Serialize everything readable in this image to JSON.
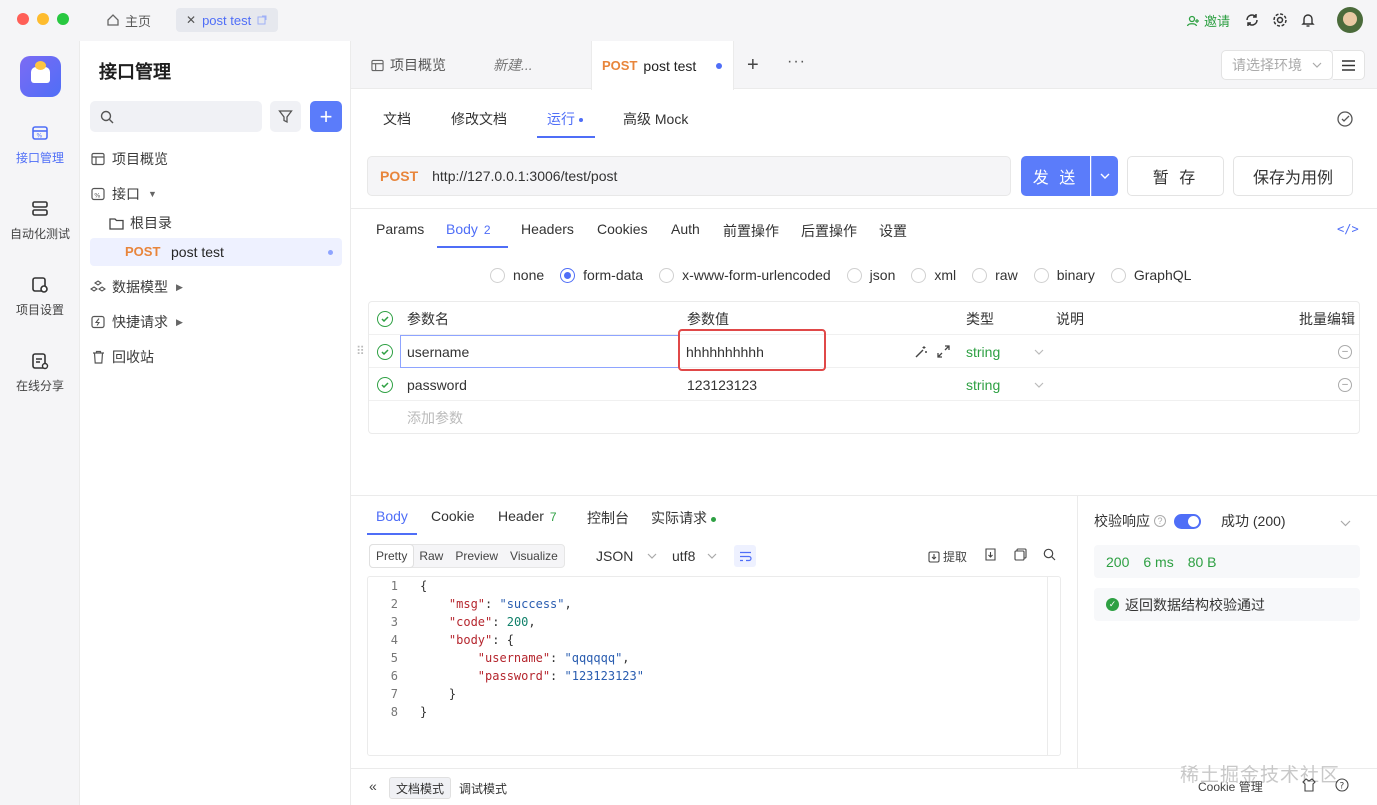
{
  "titlebar": {
    "home_label": "主页",
    "file_tab_label": "post test",
    "invite_label": "邀请"
  },
  "rail": {
    "items": [
      {
        "label": "接口管理",
        "icon": "api-icon"
      },
      {
        "label": "自动化测试",
        "icon": "automation-icon"
      },
      {
        "label": "项目设置",
        "icon": "project-settings-icon"
      },
      {
        "label": "在线分享",
        "icon": "share-icon"
      }
    ]
  },
  "sidebar": {
    "title": "接口管理",
    "tree": [
      {
        "label": "项目概览"
      },
      {
        "label": "接口"
      },
      {
        "label": "根目录"
      },
      {
        "method": "POST",
        "label": "post test"
      },
      {
        "label": "数据模型"
      },
      {
        "label": "快捷请求"
      },
      {
        "label": "回收站"
      }
    ]
  },
  "tabs": {
    "overview": "项目概览",
    "new": "新建...",
    "active_method": "POST",
    "active_label": "post test",
    "env_placeholder": "请选择环境"
  },
  "subtabs": [
    "文档",
    "修改文档",
    "运行",
    "高级 Mock"
  ],
  "request": {
    "method": "POST",
    "url": "http://127.0.0.1:3006/test/post",
    "send_label": "发 送",
    "save_label": "暂 存",
    "save_case_label": "保存为用例"
  },
  "req_tabs": {
    "params": "Params",
    "body": "Body",
    "body_count": "2",
    "headers": "Headers",
    "cookies": "Cookies",
    "auth": "Auth",
    "pre": "前置操作",
    "post": "后置操作",
    "settings": "设置"
  },
  "body_types": [
    "none",
    "form-data",
    "x-www-form-urlencoded",
    "json",
    "xml",
    "raw",
    "binary",
    "GraphQL"
  ],
  "body_type_selected": "form-data",
  "params_table": {
    "headers": {
      "name": "参数名",
      "value": "参数值",
      "type": "类型",
      "desc": "说明",
      "bulk": "批量编辑"
    },
    "rows": [
      {
        "name": "username",
        "value": "hhhhhhhhhh",
        "type": "string"
      },
      {
        "name": "password",
        "value": "123123123",
        "type": "string"
      }
    ],
    "add_placeholder": "添加参数"
  },
  "response": {
    "tabs": {
      "body": "Body",
      "cookie": "Cookie",
      "header": "Header",
      "header_count": "7",
      "console": "控制台",
      "actual": "实际请求"
    },
    "view_modes": [
      "Pretty",
      "Raw",
      "Preview",
      "Visualize"
    ],
    "format": "JSON",
    "encoding": "utf8",
    "extract_label": "提取",
    "code_lines": [
      "{",
      "    \"msg\": \"success\",",
      "    \"code\": 200,",
      "    \"body\": {",
      "        \"username\": \"qqqqqq\",",
      "        \"password\": \"123123123\"",
      "    }",
      "}"
    ]
  },
  "validation": {
    "label": "校验响应",
    "status": "成功 (200)",
    "code": "200",
    "time": "6 ms",
    "size": "80 B",
    "pass_message": "返回数据结构校验通过"
  },
  "footer": {
    "doc_mode": "文档模式",
    "debug_mode": "调试模式",
    "cookie_manager": "Cookie 管理"
  },
  "watermark": "稀土掘金技术社区",
  "colors": {
    "accent": "#4f6ef7",
    "post": "#e8853b",
    "success": "#2ea043",
    "highlight": "#e04848"
  }
}
